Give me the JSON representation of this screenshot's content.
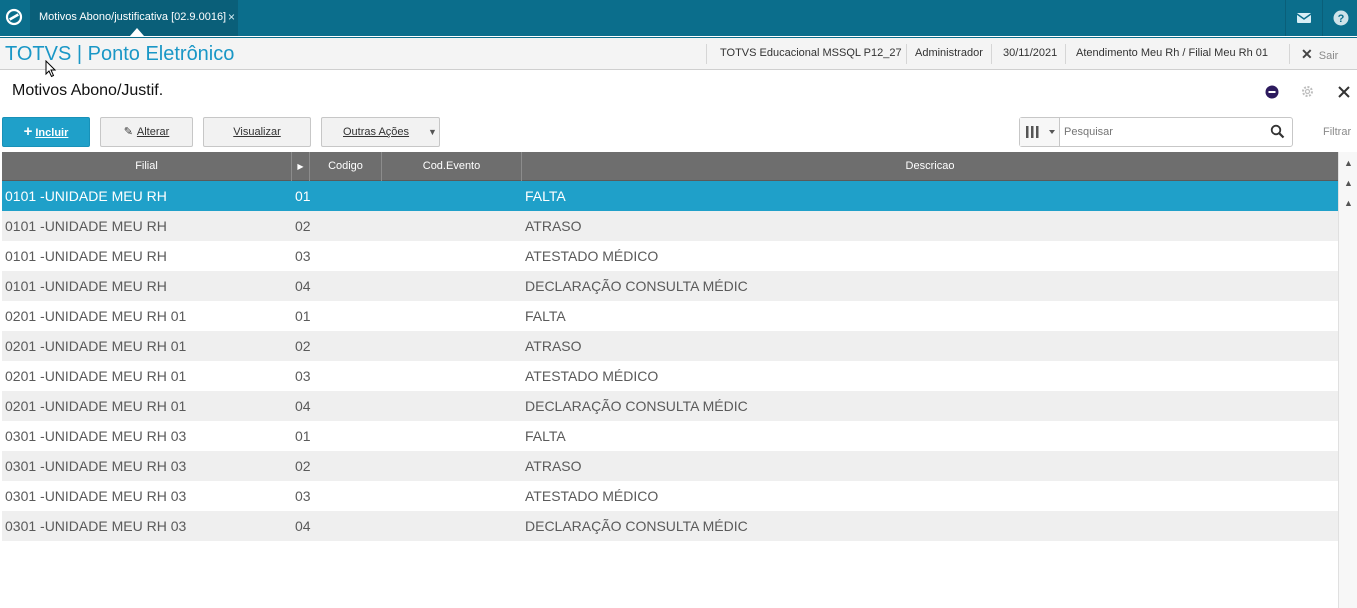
{
  "topbar": {
    "tab_title": "Motivos Abono/justificativa [02.9.0016]",
    "tab_close": "×",
    "icons": [
      "totvs-logo-icon",
      "mail-icon",
      "help-icon"
    ]
  },
  "header": {
    "brand": "TOTVS | Ponto Eletrônico",
    "environment": "TOTVS Educacional MSSQL P12_27",
    "user": "Administrador",
    "date": "30/11/2021",
    "branch": "Atendimento Meu Rh / Filial Meu Rh 01",
    "exit_label": "Sair"
  },
  "page": {
    "title": "Motivos Abono/Justif."
  },
  "toolbar": {
    "incluir": "Incluir",
    "alterar": "Alterar",
    "visualizar": "Visualizar",
    "outras_acoes": "Outras Ações",
    "search_placeholder": "Pesquisar",
    "filtrar": "Filtrar"
  },
  "grid": {
    "columns": [
      "Filial",
      "Codigo",
      "Cod.Evento",
      "Descricao"
    ],
    "selected_row": 0,
    "rows": [
      {
        "filial": "0101  -UNIDADE MEU RH",
        "codigo": "01",
        "cod_evento": "",
        "descricao": "FALTA"
      },
      {
        "filial": "0101  -UNIDADE MEU RH",
        "codigo": "02",
        "cod_evento": "",
        "descricao": "ATRASO"
      },
      {
        "filial": "0101  -UNIDADE MEU RH",
        "codigo": "03",
        "cod_evento": "",
        "descricao": "ATESTADO MÉDICO"
      },
      {
        "filial": "0101  -UNIDADE MEU RH",
        "codigo": "04",
        "cod_evento": "",
        "descricao": "DECLARAÇÃO CONSULTA MÉDIC"
      },
      {
        "filial": "0201  -UNIDADE MEU RH 01",
        "codigo": "01",
        "cod_evento": "",
        "descricao": "FALTA"
      },
      {
        "filial": "0201  -UNIDADE MEU RH 01",
        "codigo": "02",
        "cod_evento": "",
        "descricao": "ATRASO"
      },
      {
        "filial": "0201  -UNIDADE MEU RH 01",
        "codigo": "03",
        "cod_evento": "",
        "descricao": "ATESTADO MÉDICO"
      },
      {
        "filial": "0201  -UNIDADE MEU RH 01",
        "codigo": "04",
        "cod_evento": "",
        "descricao": "DECLARAÇÃO CONSULTA MÉDIC"
      },
      {
        "filial": "0301  -UNIDADE MEU RH 03",
        "codigo": "01",
        "cod_evento": "",
        "descricao": "FALTA"
      },
      {
        "filial": "0301  -UNIDADE MEU RH 03",
        "codigo": "02",
        "cod_evento": "",
        "descricao": "ATRASO"
      },
      {
        "filial": "0301  -UNIDADE MEU RH 03",
        "codigo": "03",
        "cod_evento": "",
        "descricao": "ATESTADO MÉDICO"
      },
      {
        "filial": "0301  -UNIDADE MEU RH 03",
        "codigo": "04",
        "cod_evento": "",
        "descricao": "DECLARAÇÃO CONSULTA MÉDIC"
      }
    ]
  },
  "colors": {
    "topbar": "#0b6e8c",
    "brand": "#1a97c6",
    "primary_button": "#1fa0c9",
    "selected_row": "#1fa0c9",
    "grid_header": "#6e6e6e"
  }
}
